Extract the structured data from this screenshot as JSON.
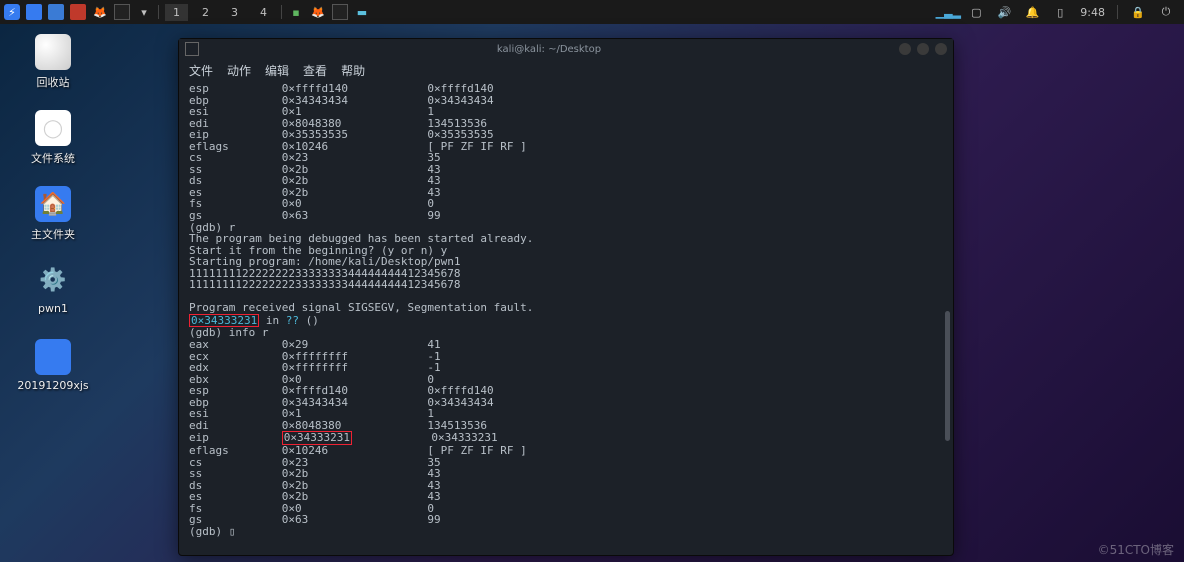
{
  "panel": {
    "workspaces": [
      "1",
      "2",
      "3",
      "4"
    ],
    "active_ws": "1",
    "time": "9:48"
  },
  "desktop": {
    "icons": [
      {
        "id": "trash",
        "label": "回收站"
      },
      {
        "id": "filesys",
        "label": "文件系统"
      },
      {
        "id": "home",
        "label": "主文件夹"
      },
      {
        "id": "pwn1",
        "label": "pwn1"
      },
      {
        "id": "folder1",
        "label": "20191209xjs"
      }
    ]
  },
  "terminal": {
    "title": "kali@kali: ~/Desktop",
    "menu": [
      "文件",
      "动作",
      "编辑",
      "查看",
      "帮助"
    ],
    "registers_before": [
      {
        "r": "esp",
        "v1": "0×ffffd140",
        "v2": "0×ffffd140"
      },
      {
        "r": "ebp",
        "v1": "0×34343434",
        "v2": "0×34343434"
      },
      {
        "r": "esi",
        "v1": "0×1",
        "v2": "1"
      },
      {
        "r": "edi",
        "v1": "0×8048380",
        "v2": "134513536"
      },
      {
        "r": "eip",
        "v1": "0×35353535",
        "v2": "0×35353535"
      },
      {
        "r": "eflags",
        "v1": "0×10246",
        "v2": "[ PF ZF IF RF ]"
      },
      {
        "r": "cs",
        "v1": "0×23",
        "v2": "35"
      },
      {
        "r": "ss",
        "v1": "0×2b",
        "v2": "43"
      },
      {
        "r": "ds",
        "v1": "0×2b",
        "v2": "43"
      },
      {
        "r": "es",
        "v1": "0×2b",
        "v2": "43"
      },
      {
        "r": "fs",
        "v1": "0×0",
        "v2": "0"
      },
      {
        "r": "gs",
        "v1": "0×63",
        "v2": "99"
      }
    ],
    "session": {
      "gdb_r": "(gdb) r",
      "already": "The program being debugged has been started already.",
      "restart": "Start it from the beginning? (y or n) y",
      "starting": "Starting program: /home/kali/Desktop/pwn1",
      "input1": "11111111222222223333333344444444412345678",
      "input2": "11111111222222223333333344444444412345678",
      "sigsegv": "Program received signal SIGSEGV, Segmentation fault.",
      "crash_addr": "0×34333231",
      "crash_rest": " in ",
      "crash_qq": "??",
      "crash_paren": " ()",
      "info_r": "(gdb) info r"
    },
    "registers_after": [
      {
        "r": "eax",
        "v1": "0×29",
        "v2": "41"
      },
      {
        "r": "ecx",
        "v1": "0×ffffffff",
        "v2": "-1"
      },
      {
        "r": "edx",
        "v1": "0×ffffffff",
        "v2": "-1"
      },
      {
        "r": "ebx",
        "v1": "0×0",
        "v2": "0"
      },
      {
        "r": "esp",
        "v1": "0×ffffd140",
        "v2": "0×ffffd140"
      },
      {
        "r": "ebp",
        "v1": "0×34343434",
        "v2": "0×34343434"
      },
      {
        "r": "esi",
        "v1": "0×1",
        "v2": "1"
      },
      {
        "r": "edi",
        "v1": "0×8048380",
        "v2": "134513536"
      },
      {
        "r": "eip",
        "v1": "0×34333231",
        "v2": "0×34333231",
        "hl": true
      },
      {
        "r": "eflags",
        "v1": "0×10246",
        "v2": "[ PF ZF IF RF ]"
      },
      {
        "r": "cs",
        "v1": "0×23",
        "v2": "35"
      },
      {
        "r": "ss",
        "v1": "0×2b",
        "v2": "43"
      },
      {
        "r": "ds",
        "v1": "0×2b",
        "v2": "43"
      },
      {
        "r": "es",
        "v1": "0×2b",
        "v2": "43"
      },
      {
        "r": "fs",
        "v1": "0×0",
        "v2": "0"
      },
      {
        "r": "gs",
        "v1": "0×63",
        "v2": "99"
      }
    ],
    "prompt": "(gdb) "
  },
  "watermark": "©51CTO博客"
}
